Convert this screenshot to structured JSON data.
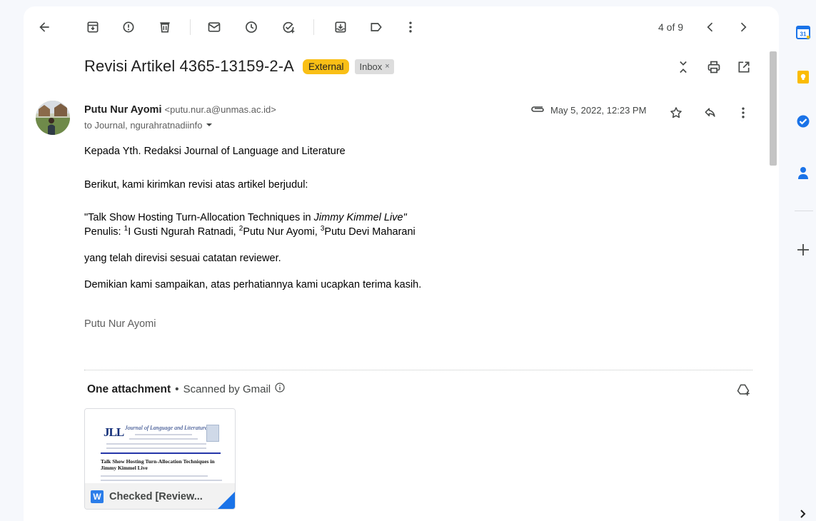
{
  "toolbar": {
    "counter": "4 of 9",
    "icons": [
      "back-arrow-icon",
      "archive-icon",
      "report-spam-icon",
      "delete-icon",
      "mark-unread-icon",
      "snooze-icon",
      "add-to-tasks-icon",
      "move-to-icon",
      "label-icon",
      "more-vert-icon",
      "newer-chevron-icon",
      "older-chevron-icon"
    ]
  },
  "subject": {
    "title": "Revisi Artikel 4365-13159-2-A",
    "external_label": "External",
    "inbox_label": "Inbox",
    "inbox_remove": "×"
  },
  "message": {
    "sender_name": "Putu Nur Ayomi",
    "sender_email": "<putu.nur.a@unmas.ac.id>",
    "to_line": "to Journal, ngurahratnadiinfo",
    "date": "May 5, 2022, 12:23 PM",
    "body": {
      "greeting": "Kepada Yth. Redaksi Journal of Language and Literature",
      "intro": "Berikut, kami kirimkan revisi atas artikel berjudul:",
      "title_prefix": "\"Talk Show Hosting Turn-Allocation Techniques in ",
      "title_italic": "Jimmy Kimmel Live\"",
      "authors_label": "Penulis: ",
      "author1_sup": "1",
      "author1": "I Gusti Ngurah Ratnadi, ",
      "author2_sup": "2",
      "author2": "Putu Nur Ayomi, ",
      "author3_sup": "3",
      "author3": "Putu Devi Maharani",
      "revised": "yang telah direvisi sesuai catatan reviewer.",
      "closing": "Demikian kami sampaikan, atas perhatiannya kami ucapkan terima kasih.",
      "signature": "Putu Nur Ayomi"
    }
  },
  "attachments": {
    "heading": "One attachment",
    "separator": "•",
    "scanned": "Scanned by Gmail",
    "file_name": "Checked [Review...",
    "file_type_letter": "W",
    "preview": {
      "logo": "JLL",
      "journal_title": "Journal of Language and Literature",
      "article_title": "Talk Show Hosting Turn-Allocation Techniques in Jimmy Kimmel Live"
    }
  },
  "side_panel": {
    "calendar_day": "31"
  },
  "colors": {
    "external_badge": "#f9bf16",
    "word_blue": "#2b7de9",
    "accent_blue": "#1a73e8"
  }
}
